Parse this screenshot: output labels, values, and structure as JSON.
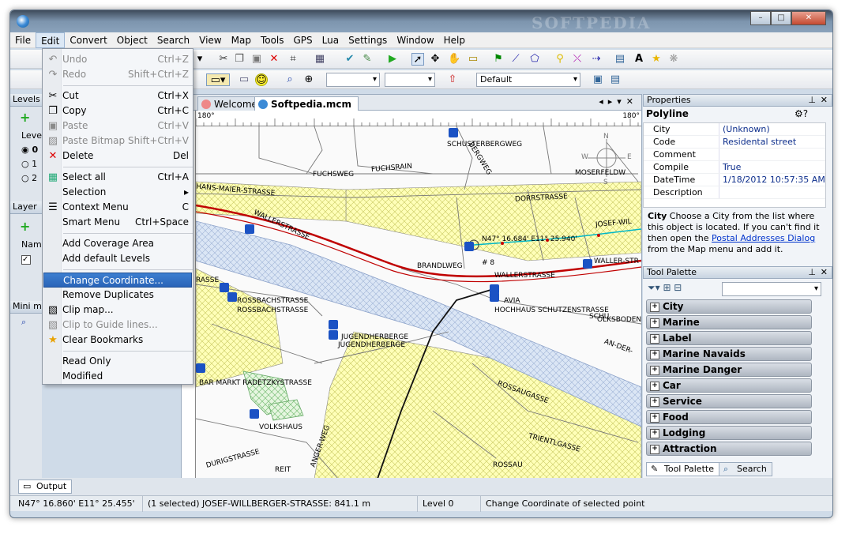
{
  "window": {
    "watermark": "SOFTPEDIA",
    "btn_min": "–",
    "btn_max": "□",
    "btn_close": "✕"
  },
  "menubar": [
    "File",
    "Edit",
    "Convert",
    "Object",
    "Search",
    "View",
    "Map",
    "Tools",
    "GPS",
    "Lua",
    "Settings",
    "Window",
    "Help"
  ],
  "edit_menu": [
    {
      "label": "Undo",
      "shortcut": "Ctrl+Z",
      "disabled": true,
      "icon": "undo-icon"
    },
    {
      "label": "Redo",
      "shortcut": "Shift+Ctrl+Z",
      "disabled": true,
      "icon": "redo-icon"
    },
    {
      "label": "Cut",
      "shortcut": "Ctrl+X",
      "disabled": false,
      "icon": "cut-icon"
    },
    {
      "label": "Copy",
      "shortcut": "Ctrl+C",
      "disabled": false,
      "icon": "copy-icon"
    },
    {
      "label": "Paste",
      "shortcut": "Ctrl+V",
      "disabled": true,
      "icon": "paste-icon"
    },
    {
      "label": "Paste Bitmap",
      "shortcut": "Shift+Ctrl+V",
      "disabled": true,
      "icon": "paste-bitmap-icon"
    },
    {
      "label": "Delete",
      "shortcut": "Del",
      "disabled": false,
      "icon": "delete-icon"
    },
    {
      "label": "Select all",
      "shortcut": "Ctrl+A",
      "disabled": false,
      "icon": "select-all-icon"
    },
    {
      "label": "Selection",
      "shortcut": "▸",
      "disabled": false,
      "icon": ""
    },
    {
      "label": "Context Menu",
      "shortcut": "C",
      "disabled": false,
      "icon": "context-menu-icon"
    },
    {
      "label": "Smart Menu",
      "shortcut": "Ctrl+Space",
      "disabled": false,
      "icon": ""
    },
    {
      "label": "Add Coverage Area",
      "shortcut": "",
      "disabled": false,
      "icon": ""
    },
    {
      "label": "Add default Levels",
      "shortcut": "",
      "disabled": false,
      "icon": ""
    },
    {
      "label": "Change Coordinate...",
      "shortcut": "",
      "disabled": false,
      "icon": ""
    },
    {
      "label": "Remove Duplicates",
      "shortcut": "",
      "disabled": false,
      "icon": ""
    },
    {
      "label": "Clip map...",
      "shortcut": "",
      "disabled": false,
      "icon": "clip-map-icon"
    },
    {
      "label": "Clip to Guide lines...",
      "shortcut": "",
      "disabled": true,
      "icon": "clip-guide-icon"
    },
    {
      "label": "Clear Bookmarks",
      "shortcut": "",
      "disabled": false,
      "icon": "bookmark-star-icon"
    },
    {
      "label": "Read Only",
      "shortcut": "",
      "disabled": false,
      "icon": ""
    },
    {
      "label": "Modified",
      "shortcut": "",
      "disabled": false,
      "icon": ""
    }
  ],
  "toolbar2": {
    "default_combo": "Default"
  },
  "left": {
    "levels": "Levels",
    "level": "Level",
    "l0": "0",
    "l1": "1",
    "l2": "2",
    "layers": "Layer",
    "name": "Name",
    "mini": "Mini m"
  },
  "tabs": {
    "welcome": "Welcome",
    "active": "Softpedia.mcm"
  },
  "ruler": {
    "left": "180°",
    "right": "180°"
  },
  "map_labels": {
    "schusterbergweg": "SCHUSTERBERGWEG",
    "bergweg": "BERGWEG",
    "fuchsweg": "FUCHSWEG",
    "fuchsrain": "FUCHSRAIN",
    "moserfeld": "MOSERFELDW",
    "hansmaier": "HANS-MAIER-STRASSE",
    "dorrstrasse": "DORRSTRASSE",
    "josef": "JOSEF-WIL",
    "waller1": "WALLERSTRASSE",
    "coord": "N47° 16.684' E11° 25.940'",
    "brandlweg": "BRANDLWEG",
    "num8": "# 8",
    "waller2": "WALLERSTRASSE",
    "waller3": "WALLER-STR",
    "rassen": "RASSE",
    "rossbach1": "ROSSBACHSTRASSE",
    "rossbach2": "ROSSBACHSTRASSE",
    "avia": "AVIA",
    "hoechhaus": "HOCHHAUS SCHUTZENSTRASSE",
    "schu": "SCHU",
    "olksboden": "OLKSBODEN",
    "jugend1": "JUGENDHERBERGE",
    "jugend2": "JUGENDHERBERGE",
    "anderl": "AN-DER-",
    "barmarkt": "BAR MARKT RADETZKYSTRASSE",
    "rossaugasse": "ROSSAUGASSE",
    "volkshaus": "VOLKSHAUS",
    "angerweg": "ANGER-WEG",
    "trientl": "TRIENTLGASSE",
    "rossau": "ROSSAU",
    "durig": "DURIGSTRASSE",
    "reit": "REIT",
    "compass_n": "N",
    "compass_s": "S",
    "compass_w": "W",
    "compass_e": "E"
  },
  "properties": {
    "header": "Properties",
    "type": "Polyline",
    "rows": [
      [
        "City",
        "(Unknown)"
      ],
      [
        "Code",
        "Residental street"
      ],
      [
        "Comment",
        ""
      ],
      [
        "Compile",
        "True"
      ],
      [
        "DateTime",
        "1/18/2012 10:57:35 AM"
      ],
      [
        "Description",
        ""
      ]
    ],
    "desc_bold": "City",
    "desc_text": "Choose a City from the list where this object is located. If you can't find it then open the",
    "desc_link": "Postal Addresses Dialog",
    "desc_tail": "from the Map menu and add it."
  },
  "tool_palette": {
    "header": "Tool Palette",
    "categories": [
      "City",
      "Marine",
      "Label",
      "Marine Navaids",
      "Marine Danger",
      "Car",
      "Service",
      "Food",
      "Lodging",
      "Attraction"
    ],
    "tab1": "Tool Palette",
    "tab2": "Search"
  },
  "output_tab": "Output",
  "status": {
    "coords": "N47° 16.860' E11° 25.455'",
    "selection": "(1 selected) JOSEF-WILLBERGER-STRASSE: 841.1 m",
    "level": "Level 0",
    "hint": "Change Coordinate of selected point"
  },
  "colors": {
    "accent": "#2a64b8",
    "road_red": "#c00000",
    "water": "#c9d9ef",
    "hatch": "#ffff99"
  }
}
